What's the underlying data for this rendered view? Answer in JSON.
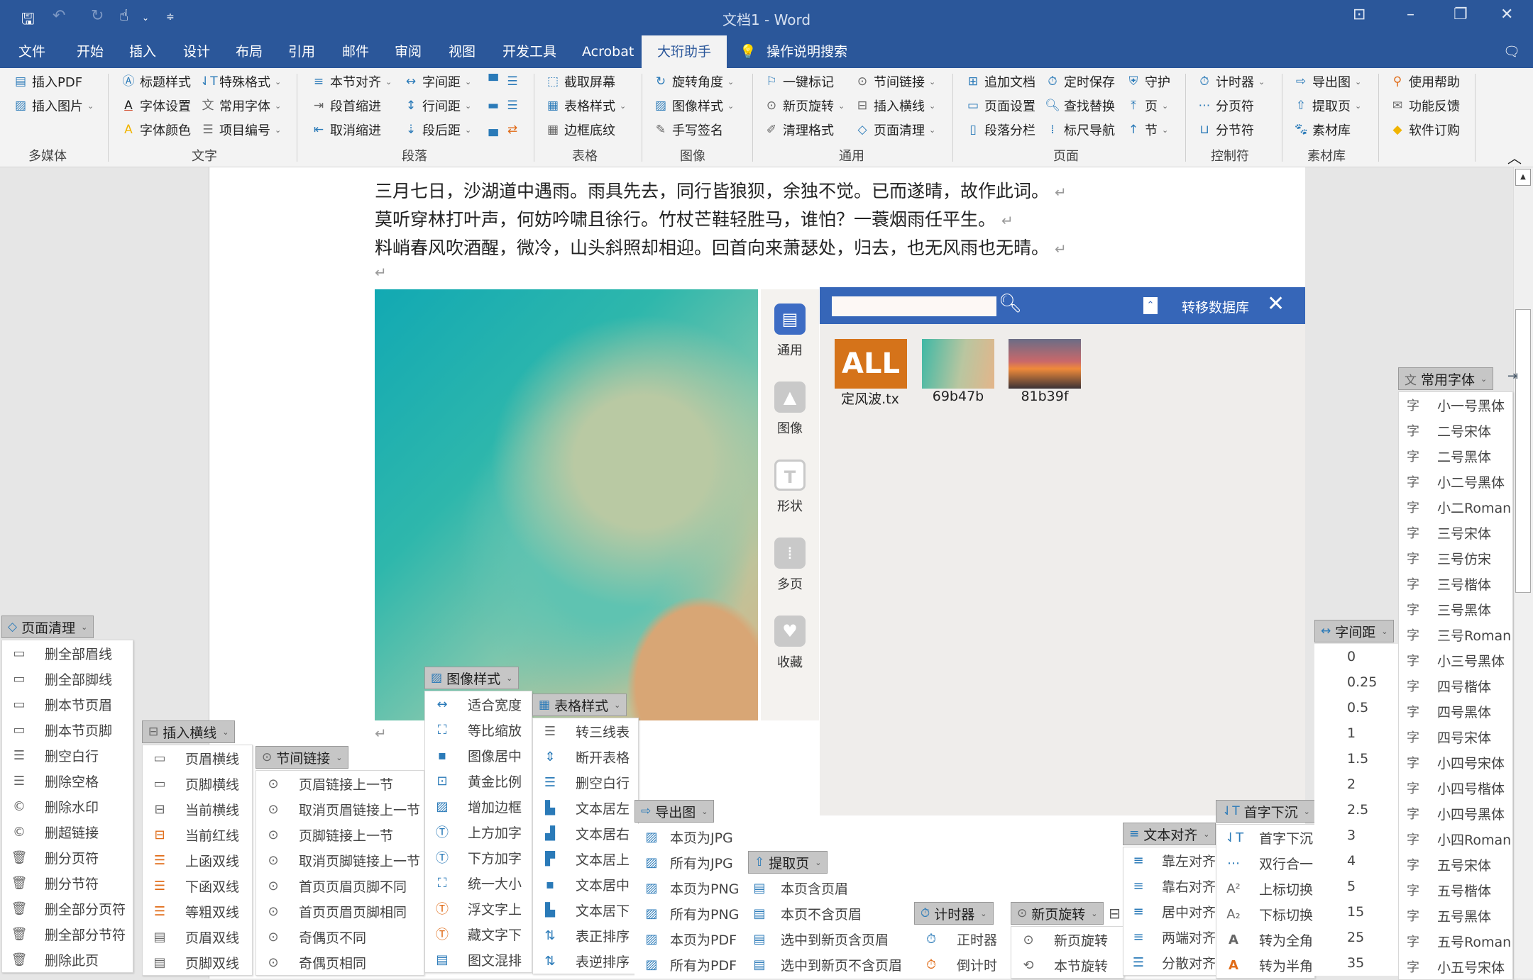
{
  "window": {
    "title": "文档1  -  Word",
    "colors": {
      "brand": "#2b579a",
      "panel_header": "#3666b8"
    }
  },
  "quick_access": {
    "icons": [
      "save-icon",
      "undo-icon",
      "redo-icon",
      "touch-mode-icon",
      "customize-icon"
    ]
  },
  "tabs": [
    {
      "label": "文件"
    },
    {
      "label": "开始"
    },
    {
      "label": "插入"
    },
    {
      "label": "设计"
    },
    {
      "label": "布局"
    },
    {
      "label": "引用"
    },
    {
      "label": "邮件"
    },
    {
      "label": "审阅"
    },
    {
      "label": "视图"
    },
    {
      "label": "开发工具"
    },
    {
      "label": "Acrobat"
    },
    {
      "label": "大珩助手",
      "active": true
    },
    {
      "label": "操作说明搜索"
    }
  ],
  "ribbon": {
    "groups": [
      "多媒体",
      "文字",
      "段落",
      "表格",
      "图像",
      "通用",
      "页面",
      "控制符",
      "素材库"
    ],
    "items": {
      "insert_pdf": "插入PDF",
      "insert_picture": "插入图片",
      "title_style": "标题样式",
      "special_format": "特殊格式",
      "font_settings": "字体设置",
      "common_fonts": "常用字体",
      "font_color": "字体颜色",
      "item_numbering": "项目编号",
      "section_align": "本节对齐",
      "char_spacing": "字间距",
      "first_indent": "段首缩进",
      "line_spacing": "行间距",
      "cancel_indent": "取消缩进",
      "after_spacing": "段后距",
      "screenshot": "截取屏幕",
      "table_style": "表格样式",
      "border_shading": "边框底纹",
      "rotate_angle": "旋转角度",
      "image_style": "图像样式",
      "handwrite_sign": "手写签名",
      "one_click_mark": "一键标记",
      "new_page_rotate": "新页旋转",
      "clear_format": "清理格式",
      "section_link": "节间链接",
      "insert_hline": "插入横线",
      "page_clean": "页面清理",
      "append_doc": "追加文档",
      "page_setup": "页面设置",
      "paragraph_columns": "段落分栏",
      "timed_save": "定时保存",
      "find_replace": "查找替换",
      "ruler_nav": "标尺导航",
      "guard": "守护",
      "page": "页",
      "section": "节",
      "timer": "计时器",
      "page_break": "分页符",
      "section_break": "分节符",
      "export_image": "导出图",
      "extract_page": "提取页",
      "material_lib": "素材库",
      "help": "使用帮助",
      "feedback": "功能反馈",
      "subscribe": "软件订购"
    }
  },
  "document": {
    "lines": [
      "三月七日，沙湖道中遇雨。雨具先去，同行皆狼狈，余独不觉。已而遂晴，故作此词。",
      "莫听穿林打叶声，何妨吟啸且徐行。竹杖芒鞋轻胜马，谁怕？一蓑烟雨任平生。",
      "料峭春风吹酒醒，微冷，山头斜照却相迎。回首向来萧瑟处，归去，也无风雨也无晴。"
    ],
    "return_mark": "↵"
  },
  "material_panel": {
    "sidebar": [
      "通用",
      "图像",
      "形状",
      "多页",
      "收藏"
    ],
    "search_placeholder": "",
    "transfer_label": "转移数据库",
    "items": [
      {
        "label": "定风波.tx",
        "badge": "ALL"
      },
      {
        "label": "69b47b"
      },
      {
        "label": "81b39f"
      }
    ]
  },
  "menus": {
    "page_clean": {
      "title": "页面清理",
      "items": [
        "删全部眉线",
        "删全部脚线",
        "删本节页眉",
        "删本节页脚",
        "删空白行",
        "删除空格",
        "删除水印",
        "删超链接",
        "删分页符",
        "删分节符",
        "删全部分页符",
        "删全部分节符",
        "删除此页"
      ]
    },
    "insert_hline": {
      "title": "插入横线",
      "items": [
        "页眉横线",
        "页脚横线",
        "当前横线",
        "当前红线",
        "上函双线",
        "下函双线",
        "等粗双线",
        "页眉双线",
        "页脚双线"
      ]
    },
    "section_link": {
      "title": "节间链接",
      "items": [
        "页眉链接上一节",
        "取消页眉链接上一节",
        "页脚链接上一节",
        "取消页脚链接上一节",
        "首页页眉页脚不同",
        "首页页眉页脚相同",
        "奇偶页不同",
        "奇偶页相同"
      ]
    },
    "image_style": {
      "title": "图像样式",
      "items": [
        "适合宽度",
        "等比缩放",
        "图像居中",
        "黄金比例",
        "增加边框",
        "上方加字",
        "下方加字",
        "统一大小",
        "浮文字上",
        "藏文字下",
        "图文混排"
      ]
    },
    "table_style": {
      "title": "表格样式",
      "items": [
        "转三线表",
        "断开表格",
        "删空白行",
        "文本居左",
        "文本居右",
        "文本居上",
        "文本居中",
        "文本居下",
        "表正排序",
        "表逆排序"
      ]
    },
    "export_image": {
      "title": "导出图",
      "items": [
        "本页为JPG",
        "所有为JPG",
        "本页为PNG",
        "所有为PNG",
        "本页为PDF",
        "所有为PDF"
      ]
    },
    "extract_page": {
      "title": "提取页",
      "items": [
        "本页含页眉",
        "本页不含页眉",
        "选中到新页含页眉",
        "选中到新页不含页眉"
      ]
    },
    "timer": {
      "title": "计时器",
      "items": [
        "正时器",
        "倒计时"
      ]
    },
    "new_page_rotate": {
      "title": "新页旋转",
      "items": [
        "新页旋转",
        "本节旋转"
      ]
    },
    "text_align": {
      "title": "文本对齐",
      "items": [
        "靠左对齐",
        "靠右对齐",
        "居中对齐",
        "两端对齐",
        "分散对齐"
      ]
    },
    "drop_cap": {
      "title": "首字下沉",
      "items": [
        "首字下沉",
        "双行合一",
        "上标切换",
        "下标切换",
        "转为全角",
        "转为半角"
      ]
    },
    "char_spacing": {
      "title": "字间距",
      "items": [
        "0",
        "0.25",
        "0.5",
        "1",
        "1.5",
        "2",
        "2.5",
        "3",
        "4",
        "5",
        "15",
        "25",
        "35"
      ]
    },
    "common_fonts": {
      "title": "常用字体",
      "glyph": "字",
      "items": [
        "小一号黑体",
        "二号宋体",
        "二号黑体",
        "小二号黑体",
        "小二Roman",
        "三号宋体",
        "三号仿宋",
        "三号楷体",
        "三号黑体",
        "三号Roman",
        "小三号黑体",
        "四号楷体",
        "四号黑体",
        "四号宋体",
        "小四号宋体",
        "小四号楷体",
        "小四号黑体",
        "小四Roman",
        "五号宋体",
        "五号楷体",
        "五号黑体",
        "五号Roman",
        "小五号宋体"
      ]
    }
  }
}
